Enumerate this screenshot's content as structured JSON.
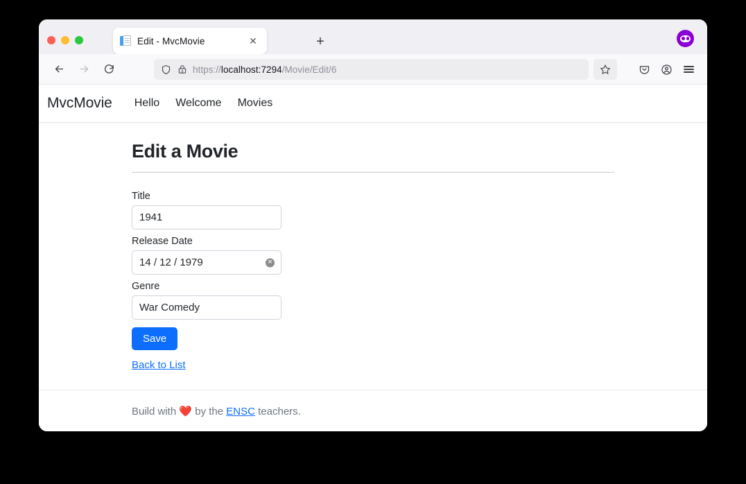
{
  "window": {
    "traffic_lights": [
      "close",
      "minimize",
      "zoom"
    ]
  },
  "browser": {
    "tab": {
      "title": "Edit - MvcMovie",
      "favicon": "document-icon",
      "close_label": "✕"
    },
    "new_tab_label": "+",
    "relay_icon": "firefox-relay-mask-icon",
    "nav": {
      "back_label": "←",
      "forward_label": "→",
      "reload_label": "↻"
    },
    "urlbar": {
      "shield_icon": "shield-icon",
      "lock_icon": "lock-warning-icon",
      "url_prefix": "https://",
      "url_host": "localhost:7294",
      "url_path": "/Movie/Edit/6",
      "full_url": "https://localhost:7294/Movie/Edit/6"
    },
    "toolbar_right": {
      "bookmark_icon": "star-icon",
      "pocket_icon": "pocket-icon",
      "account_icon": "account-circle-icon",
      "menu_icon": "hamburger-menu-icon"
    }
  },
  "site": {
    "brand": "MvcMovie",
    "nav_links": [
      {
        "label": "Hello"
      },
      {
        "label": "Welcome"
      },
      {
        "label": "Movies"
      }
    ]
  },
  "main": {
    "page_title": "Edit a Movie",
    "fields": [
      {
        "label": "Title",
        "value": "1941",
        "name": "title"
      },
      {
        "label": "Release Date",
        "value": "14 / 12 / 1979",
        "name": "release-date"
      },
      {
        "label": "Genre",
        "value": "War Comedy",
        "name": "genre"
      }
    ],
    "save_label": "Save",
    "back_link_label": "Back to List"
  },
  "footer": {
    "prefix": "Build with ",
    "heart": "❤️",
    "middle": " by the ",
    "link": "ENSC",
    "suffix": " teachers."
  },
  "colors": {
    "accent_blue": "#0d6efd",
    "relay_purple": "#8a00d4",
    "heart_red": "#e8493f",
    "muted_text": "#6c757d"
  }
}
